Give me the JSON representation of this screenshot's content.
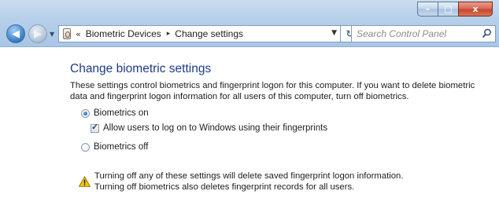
{
  "window": {
    "caption_buttons": {
      "minimize_glyph": "–",
      "maximize_glyph": "□",
      "close_glyph": "x"
    }
  },
  "navigation": {
    "back_icon": "back-arrow-icon",
    "forward_icon": "forward-arrow-icon",
    "address": {
      "chevrons": "«",
      "breadcrumbs": [
        "Biometric Devices",
        "Change settings"
      ],
      "separator": "▸"
    },
    "search": {
      "placeholder": "Search Control Panel"
    }
  },
  "main": {
    "title": "Change biometric settings",
    "description": "These settings control biometrics and fingerprint logon for this computer. If you want to delete biometric data and fingerprint logon information for all users of this computer, turn off biometrics.",
    "options": {
      "biometrics_on": {
        "label": "Biometrics on",
        "selected": true
      },
      "allow_logon": {
        "label": "Allow users to log on to Windows using their fingerprints",
        "checked": true
      },
      "biometrics_off": {
        "label": "Biometrics off",
        "selected": false
      }
    },
    "warning": {
      "line1": "Turning off any of these settings will delete saved fingerprint logon information.",
      "line2": "Turning off biometrics also deletes fingerprint records for all users."
    }
  },
  "colors": {
    "title_blue": "#1e3a8a",
    "frame_blue": "#b7d0ea",
    "close_red": "#c3442a",
    "warning_yellow": "#f5c400"
  }
}
